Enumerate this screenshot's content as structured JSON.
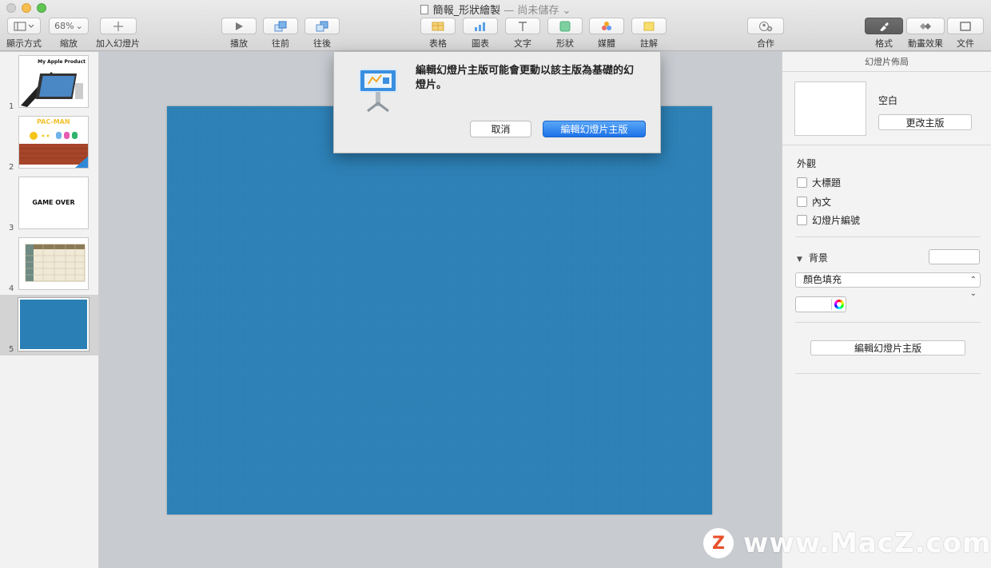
{
  "window": {
    "title": "簡報_形狀繪製",
    "separator": " — ",
    "status": "尚未儲存",
    "status_chevron": "⌄"
  },
  "toolbar": {
    "view": {
      "label": "顯示方式"
    },
    "zoom": {
      "label": "縮放",
      "value": "68%"
    },
    "add_slide": {
      "label": "加入幻燈片"
    },
    "play": {
      "label": "播放"
    },
    "forward": {
      "label": "往前"
    },
    "backward": {
      "label": "往後"
    },
    "table": {
      "label": "表格"
    },
    "chart": {
      "label": "圖表"
    },
    "text": {
      "label": "文字"
    },
    "shape": {
      "label": "形狀"
    },
    "media": {
      "label": "媒體"
    },
    "comment": {
      "label": "註解"
    },
    "collaborate": {
      "label": "合作"
    },
    "format": {
      "label": "格式"
    },
    "animate": {
      "label": "動畫效果"
    },
    "document": {
      "label": "文件"
    }
  },
  "slides": [
    {
      "number": "1",
      "caption": "My Apple Product"
    },
    {
      "number": "2",
      "caption": "PAC-MAN"
    },
    {
      "number": "3",
      "caption": "GAME OVER"
    },
    {
      "number": "4",
      "caption": ""
    },
    {
      "number": "5",
      "caption": ""
    }
  ],
  "dialog": {
    "message": "編輯幻燈片主版可能會更動以該主版為基礎的幻燈片。",
    "cancel": "取消",
    "confirm": "編輯幻燈片主版"
  },
  "inspector": {
    "header": "幻燈片佈局",
    "layout_name": "空白",
    "change_master": "更改主版",
    "appearance_title": "外觀",
    "appearance_options": [
      {
        "label": "大標題",
        "checked": false
      },
      {
        "label": "內文",
        "checked": false
      },
      {
        "label": "幻燈片編號",
        "checked": false
      }
    ],
    "background_title": "背景",
    "fill_type": "顏色填充",
    "edit_master": "編輯幻燈片主版"
  },
  "colors": {
    "slide_background": "#2a7fb5",
    "accent": "#1d72e8"
  },
  "watermark": {
    "logo": "Z",
    "text": "www.MacZ.com"
  }
}
